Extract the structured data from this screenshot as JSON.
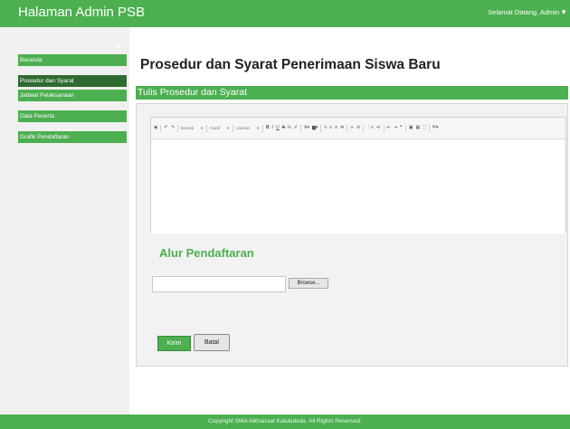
{
  "header": {
    "brand": "Halaman Admin PSB",
    "welcome": "Selamat Datang, Admin",
    "caret": "▼"
  },
  "sidebar": {
    "collapse_caret": "▼",
    "items": [
      {
        "label": "Beranda",
        "active": false
      },
      {
        "label": "Prosedur dan Syarat",
        "active": true
      },
      {
        "label": "Jadwal Pelaksanaan",
        "active": false
      },
      {
        "label": "Data Peserta",
        "active": false
      },
      {
        "label": "Grafik Pendaftaran",
        "active": false
      }
    ]
  },
  "main": {
    "page_title": "Prosedur dan Syarat Penerimaan Siswa Baru",
    "section_title": "Tulis Prosedur dan Syarat",
    "editor": {
      "toolbar": {
        "format_placeholder": "Bentuk",
        "font_placeholder": "Huruf",
        "size_placeholder": "Ukuran"
      }
    },
    "subheading": "Alur Pendaftaran",
    "file_input": {
      "value": "",
      "browse_label": "Browse..."
    },
    "submit_label": "Kirim",
    "cancel_label": "Batal"
  },
  "footer": {
    "text": "Copyright SMA Alkhairaat Kalukubula. All Rights Reserved."
  },
  "colors": {
    "accent": "#4caf50",
    "active_nav": "#2e6b31",
    "panel_bg": "#f2f2f2"
  }
}
